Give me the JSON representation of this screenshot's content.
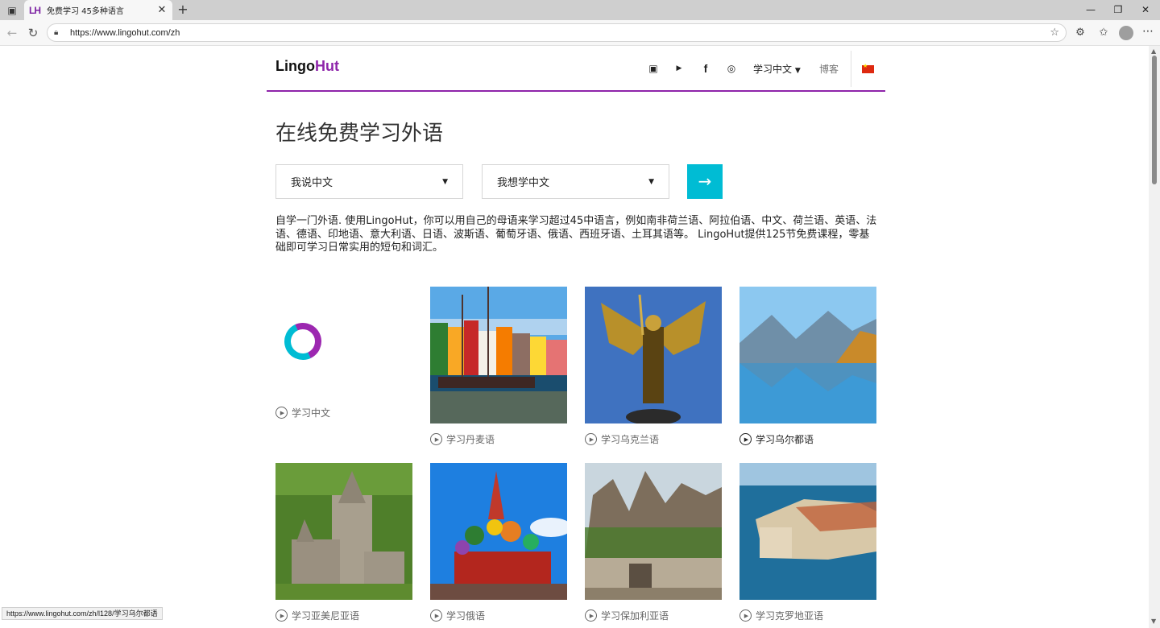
{
  "browser": {
    "tab_title": "免费学习 45多种语言",
    "tab_favicon": "LH",
    "url": "https://www.lingohut.com/zh"
  },
  "header": {
    "logo_lingo": "Lingo",
    "logo_hut": "Hut",
    "language_menu": "学习中文",
    "blog": "博客"
  },
  "hero": {
    "title": "在线免费学习外语",
    "speak_select": "我说中文",
    "learn_select": "我想学中文",
    "go_arrow": "→",
    "intro": "自学一门外语. 使用LingoHut，你可以用自己的母语来学习超过45中语言，例如南非荷兰语、阿拉伯语、中文、荷兰语、英语、法语、德语、印地语、意大利语、日语、波斯语、葡萄牙语、俄语、西班牙语、土耳其语等。 LingoHut提供125节免费课程，零基础即可学习日常实用的短句和词汇。"
  },
  "cards": [
    {
      "caption": "学习中文"
    },
    {
      "caption": "学习丹麦语"
    },
    {
      "caption": "学习乌克兰语"
    },
    {
      "caption": "学习乌尔都语"
    },
    {
      "caption": "学习亚美尼亚语"
    },
    {
      "caption": "学习俄语"
    },
    {
      "caption": "学习保加利亚语"
    },
    {
      "caption": "学习克罗地亚语"
    }
  ],
  "status_bar": "https://www.lingohut.com/zh/l128/学习乌尔都语",
  "colors": {
    "brand_purple": "#8e24aa",
    "accent_cyan": "#00bcd4",
    "flag_red": "#de2910"
  }
}
